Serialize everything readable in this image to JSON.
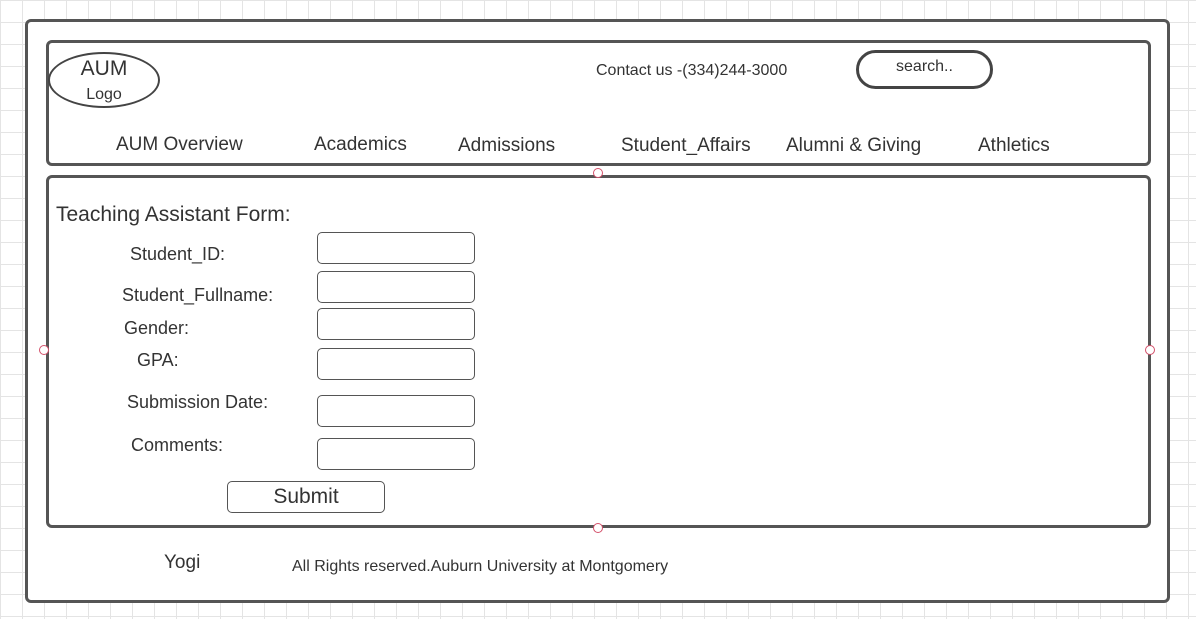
{
  "header": {
    "logo_title": "AUM",
    "logo_subtitle": "Logo",
    "contact": "Contact us -(334)244-3000",
    "search_label": "search.."
  },
  "nav": [
    {
      "label": "AUM Overview"
    },
    {
      "label": "Academics"
    },
    {
      "label": "Admissions"
    },
    {
      "label": "Student_Affairs"
    },
    {
      "label": "Alumni & Giving"
    },
    {
      "label": "Athletics"
    }
  ],
  "form": {
    "title": "Teaching Assistant Form:",
    "labels": {
      "student_id": "Student_ID:",
      "student_fullname": "Student_Fullname:",
      "gender": "Gender:",
      "gpa": "GPA:",
      "submission_date": "Submission Date:",
      "comments": "Comments:"
    },
    "values": {
      "student_id": "",
      "student_fullname": "",
      "gender": "",
      "gpa": "",
      "submission_date": "",
      "comments": ""
    },
    "submit_label": "Submit"
  },
  "footer": {
    "author": "Yogi",
    "copyright": "All Rights reserved.Auburn University at Montgomery"
  }
}
